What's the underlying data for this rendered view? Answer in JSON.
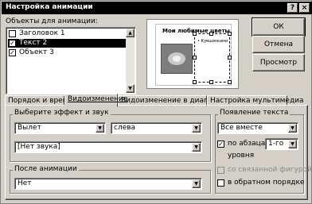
{
  "window": {
    "title": "Настройка анимации"
  },
  "titlebar_buttons": {
    "help": "?",
    "close": "×"
  },
  "objects": {
    "label": "Объекты для анимации:",
    "items": [
      {
        "label": "Заголовок 1",
        "checked": false,
        "selected": false
      },
      {
        "label": "Текст 2",
        "checked": true,
        "selected": true
      },
      {
        "label": "Объект 3",
        "checked": true,
        "selected": false
      }
    ]
  },
  "preview": {
    "slide_title": "Мои любимые цветы",
    "bullet_text": "• Кувшинками"
  },
  "buttons": {
    "ok": "ОК",
    "cancel": "Отмена",
    "preview": "Просмотр"
  },
  "tabs": [
    {
      "label": "Порядок и время",
      "active": false
    },
    {
      "label": "Видоизменение",
      "active": true
    },
    {
      "label": "Видоизменение в диаграмме",
      "active": false
    },
    {
      "label": "Настройка мультимедиа",
      "active": false
    }
  ],
  "effect_group": {
    "title": "Выберите эффект и звук",
    "effect": "Вылет",
    "direction": "слева",
    "sound": "[Нет звука]"
  },
  "after_group": {
    "title": "После анимации",
    "value": "Нет"
  },
  "text_group": {
    "title": "Появление текста",
    "appear": "Все вместе",
    "by_paragraph_label": "по абзацам",
    "by_paragraph_checked": true,
    "level": "1-го",
    "level_suffix": "уровня",
    "attached_shape_label": "со связанной фигурой",
    "attached_shape_checked": false,
    "reverse_label": "в обратном порядке",
    "reverse_checked": false
  }
}
